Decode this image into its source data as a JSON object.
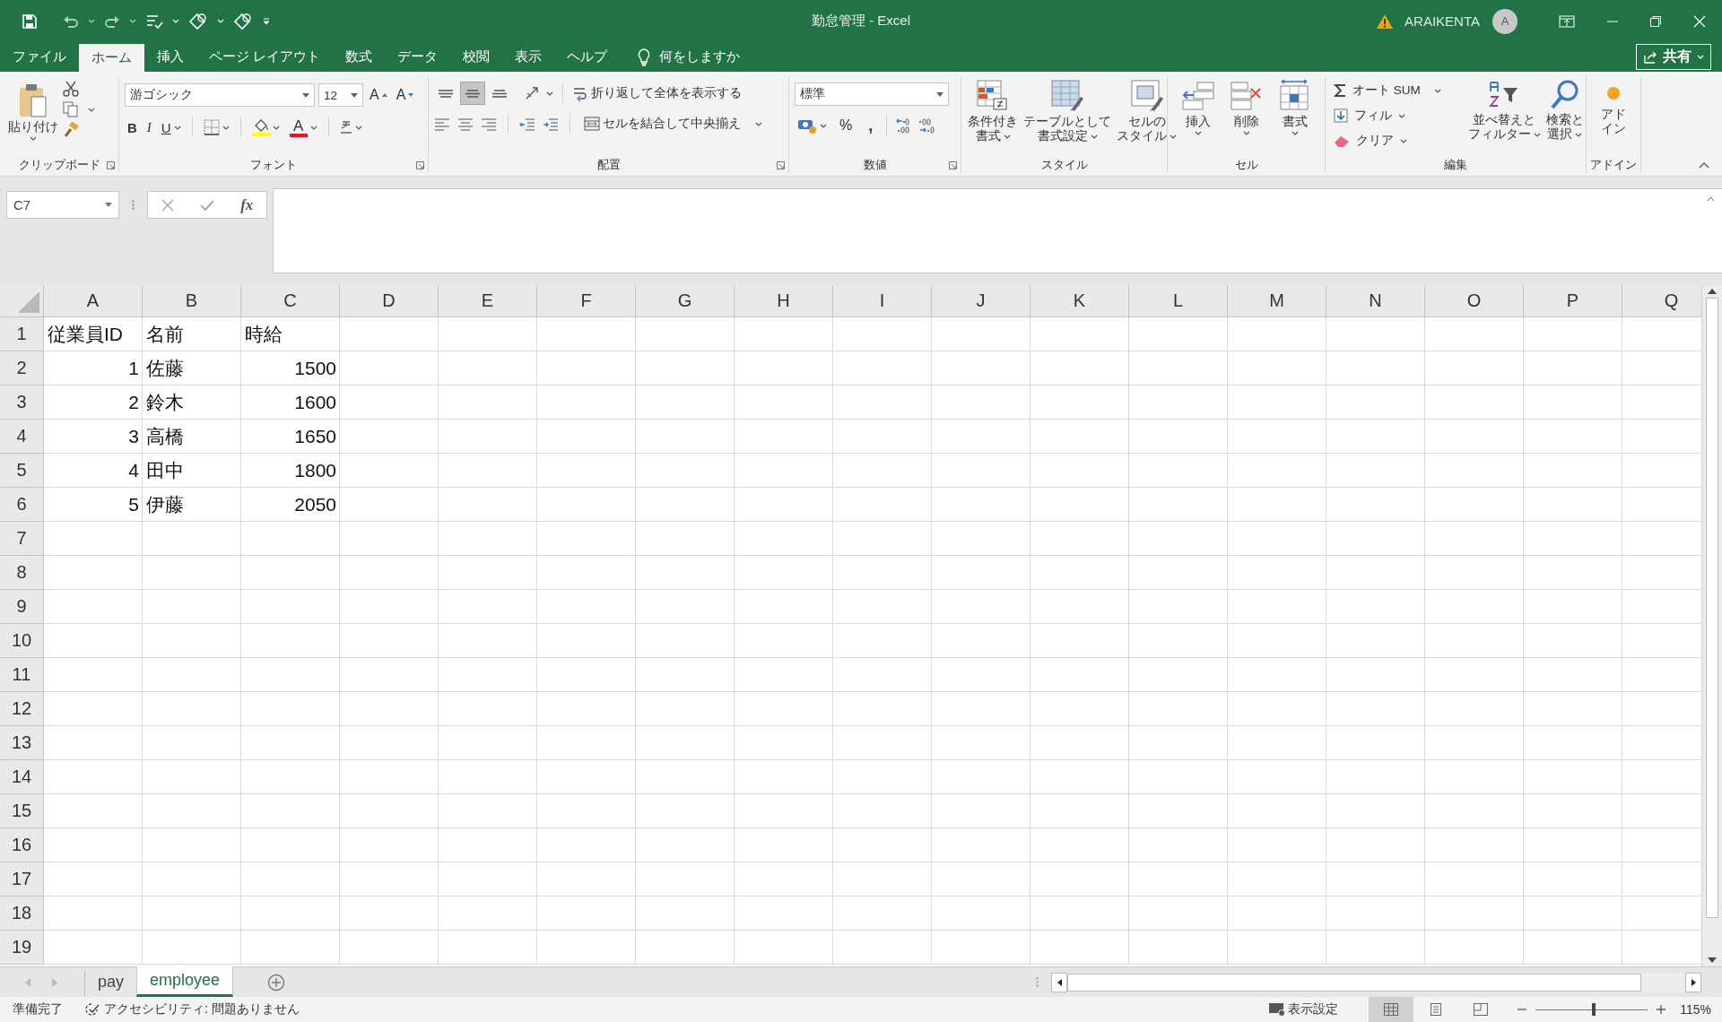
{
  "window": {
    "title": "勤怠管理 - Excel",
    "user": "ARAIKENTA",
    "avatar": "A"
  },
  "menu_tabs": [
    {
      "label": "ファイル",
      "selected": false
    },
    {
      "label": "ホーム",
      "selected": true
    },
    {
      "label": "挿入",
      "selected": false
    },
    {
      "label": "ページ レイアウト",
      "selected": false
    },
    {
      "label": "数式",
      "selected": false
    },
    {
      "label": "データ",
      "selected": false
    },
    {
      "label": "校閲",
      "selected": false
    },
    {
      "label": "表示",
      "selected": false
    },
    {
      "label": "ヘルプ",
      "selected": false
    }
  ],
  "tell_me": "何をしますか",
  "share": "共有",
  "ribbon": {
    "clipboard": {
      "label": "クリップボード",
      "paste": "貼り付け"
    },
    "font": {
      "label": "フォント",
      "font_name": "游ゴシック",
      "font_size": "12",
      "grow": "A",
      "shrink": "A",
      "bold": "B",
      "italic": "I",
      "underline": "U",
      "font_color": "A"
    },
    "alignment": {
      "label": "配置",
      "vertical": [
        {
          "kind": "top",
          "selected": false
        },
        {
          "kind": "middle",
          "selected": true
        },
        {
          "kind": "bottom",
          "selected": false
        }
      ],
      "wrap_text": "折り返して全体を表示する",
      "merge": "セルを結合して中央揃え"
    },
    "number": {
      "label": "数値",
      "format": "標準",
      "percent": "%",
      "comma": ","
    },
    "styles": {
      "label": "スタイル",
      "buttons": [
        {
          "kind": "conditional",
          "lines": [
            "条件付き",
            "書式"
          ]
        },
        {
          "kind": "table",
          "lines": [
            "テーブルとして",
            "書式設定"
          ]
        },
        {
          "kind": "cell-styles",
          "lines": [
            "セルの",
            "スタイル"
          ]
        }
      ]
    },
    "cells": {
      "label": "セル",
      "buttons": [
        {
          "kind": "insert",
          "label": "挿入"
        },
        {
          "kind": "delete",
          "label": "削除"
        },
        {
          "kind": "format",
          "label": "書式"
        }
      ]
    },
    "editing": {
      "label": "編集",
      "autosum": "オート SUM",
      "fill": "フィル",
      "clear": "クリア",
      "sort": [
        "並べ替えと",
        "フィルター"
      ],
      "find": [
        "検索と",
        "選択"
      ]
    },
    "addins": {
      "label": "アドイン",
      "button": [
        "アド",
        "イン"
      ]
    }
  },
  "formula_bar": {
    "name_box": "C7",
    "function": "fx"
  },
  "sheet": {
    "columns": [
      "A",
      "B",
      "C",
      "D",
      "E",
      "F",
      "G",
      "H",
      "I",
      "J",
      "K",
      "L",
      "M",
      "N",
      "O",
      "P",
      "Q"
    ],
    "rows": [
      {
        "number": "1",
        "cells": [
          {
            "text": "従業員ID",
            "numeric": false
          },
          {
            "text": "名前",
            "numeric": false
          },
          {
            "text": "時給",
            "numeric": false
          }
        ]
      },
      {
        "number": "2",
        "cells": [
          {
            "text": "1",
            "numeric": true
          },
          {
            "text": "佐藤",
            "numeric": false
          },
          {
            "text": "1500",
            "numeric": true
          }
        ]
      },
      {
        "number": "3",
        "cells": [
          {
            "text": "2",
            "numeric": true
          },
          {
            "text": "鈴木",
            "numeric": false
          },
          {
            "text": "1600",
            "numeric": true
          }
        ]
      },
      {
        "number": "4",
        "cells": [
          {
            "text": "3",
            "numeric": true
          },
          {
            "text": "高橋",
            "numeric": false
          },
          {
            "text": "1650",
            "numeric": true
          }
        ]
      },
      {
        "number": "5",
        "cells": [
          {
            "text": "4",
            "numeric": true
          },
          {
            "text": "田中",
            "numeric": false
          },
          {
            "text": "1800",
            "numeric": true
          }
        ]
      },
      {
        "number": "6",
        "cells": [
          {
            "text": "5",
            "numeric": true
          },
          {
            "text": "伊藤",
            "numeric": false
          },
          {
            "text": "2050",
            "numeric": true
          }
        ]
      },
      {
        "number": "7"
      },
      {
        "number": "8"
      },
      {
        "number": "9"
      },
      {
        "number": "10"
      },
      {
        "number": "11"
      },
      {
        "number": "12"
      },
      {
        "number": "13"
      },
      {
        "number": "14"
      },
      {
        "number": "15"
      },
      {
        "number": "16"
      },
      {
        "number": "17"
      },
      {
        "number": "18"
      },
      {
        "number": "19"
      }
    ]
  },
  "sheet_tabs": [
    {
      "label": "pay",
      "selected": false
    },
    {
      "label": "employee",
      "selected": true
    }
  ],
  "status_bar": {
    "ready": "準備完了",
    "accessibility": "アクセシビリティ: 問題ありません",
    "display_settings": "表示設定",
    "views": [
      {
        "kind": "normal",
        "selected": true
      },
      {
        "kind": "page-layout",
        "selected": false
      },
      {
        "kind": "page-break",
        "selected": false
      }
    ],
    "zoom": {
      "level": 0.52,
      "label": "115%"
    }
  }
}
